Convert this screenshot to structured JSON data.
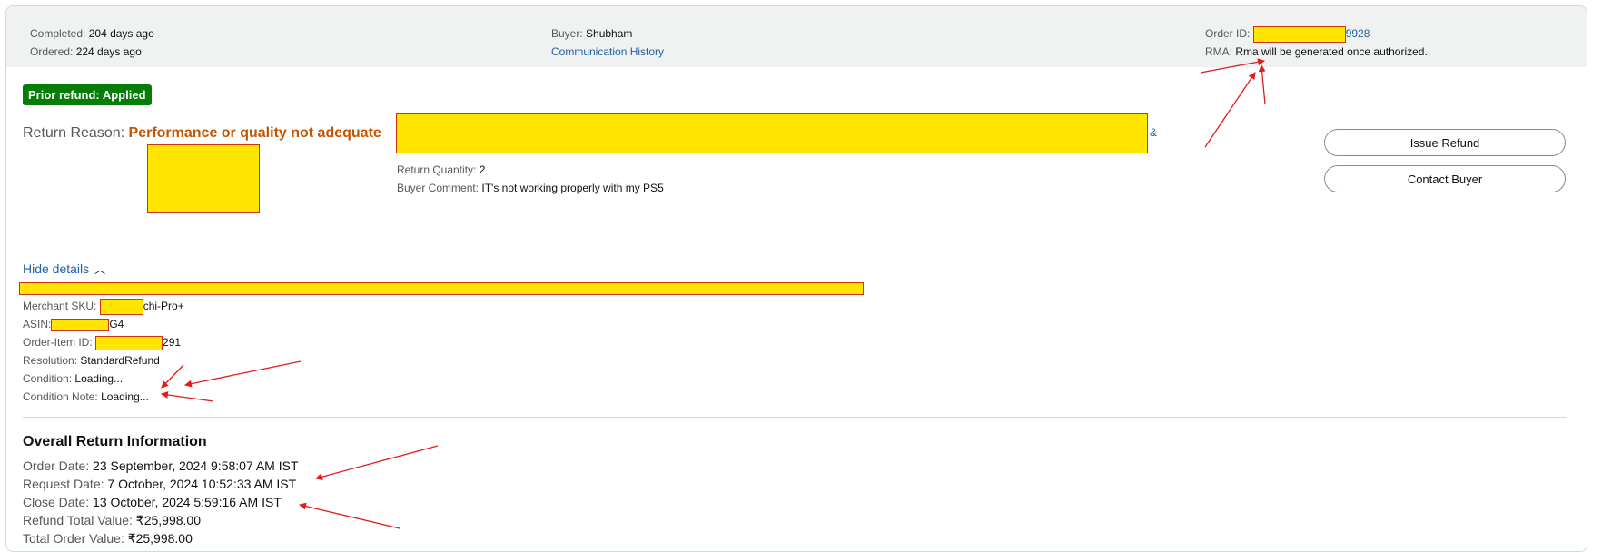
{
  "header": {
    "completed_label": "Completed:",
    "completed_value": "204 days ago",
    "ordered_label": "Ordered:",
    "ordered_value": "224 days ago",
    "buyer_label": "Buyer:",
    "buyer_value": "Shubham",
    "communication_history": "Communication History",
    "order_id_label": "Order ID:",
    "order_id_suffix": "9928",
    "rma_label": "RMA:",
    "rma_value": "Rma will be generated once authorized."
  },
  "badge": "Prior refund: Applied",
  "return_reason": {
    "label": "Return Reason:",
    "value": "Performance or quality not adequate",
    "trailing_char": "&"
  },
  "actions": {
    "issue_refund": "Issue Refund",
    "contact_buyer": "Contact Buyer"
  },
  "return_info": {
    "quantity_label": "Return Quantity:",
    "quantity_value": "2",
    "comment_label": "Buyer Comment:",
    "comment_value": "IT's not working properly with my PS5"
  },
  "details": {
    "toggle": "Hide details",
    "merchant_sku_label": "Merchant SKU:",
    "merchant_sku_suffix": "chi-Pro+",
    "asin_label": "ASIN:",
    "asin_suffix": "G4",
    "order_item_label": "Order-Item ID:",
    "order_item_suffix": "291",
    "resolution_label": "Resolution:",
    "resolution_value": "StandardRefund",
    "condition_label": "Condition:",
    "condition_value": "Loading...",
    "condition_note_label": "Condition Note:",
    "condition_note_value": "Loading..."
  },
  "overall": {
    "heading": "Overall Return Information",
    "order_date_label": "Order Date:",
    "order_date_value": "23 September, 2024 9:58:07 AM IST",
    "request_date_label": "Request Date:",
    "request_date_value": "7 October, 2024 10:52:33 AM IST",
    "close_date_label": "Close Date:",
    "close_date_value": "13 October, 2024 5:59:16 AM IST",
    "refund_total_label": "Refund Total Value:",
    "refund_total_value": "₹25,998.00",
    "order_total_label": "Total Order Value:",
    "order_total_value": "₹25,998.00"
  },
  "colors": {
    "accent_link": "#2162a1",
    "reason_orange": "#c45500",
    "badge_green": "#067d06",
    "redaction_fill": "#ffe500",
    "annotation_red": "#e01b1b"
  }
}
